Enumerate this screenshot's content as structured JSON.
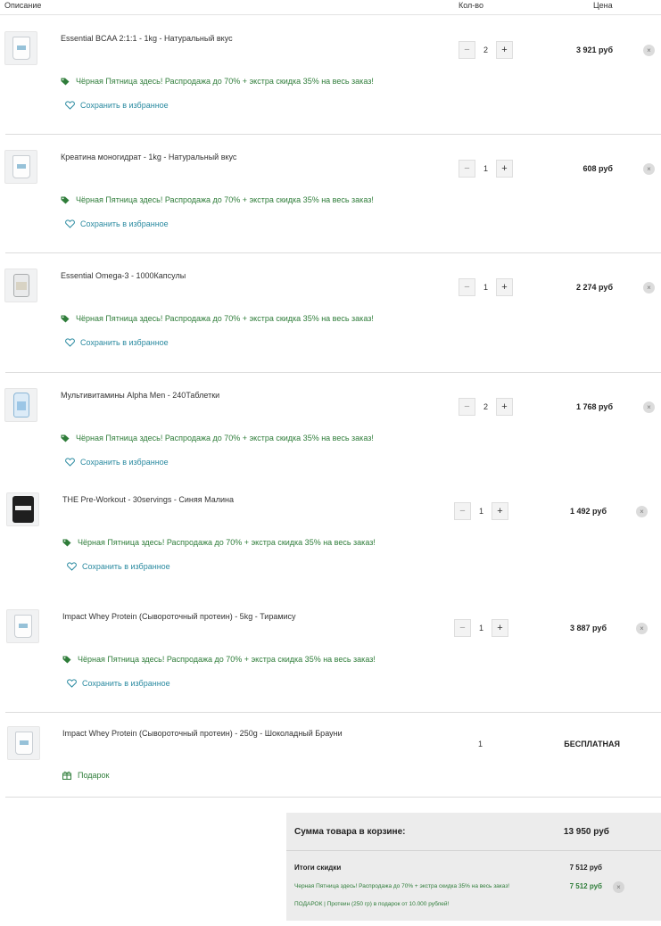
{
  "header": {
    "col_description": "Описание",
    "col_qty": "Кол-во",
    "col_price": "Цена"
  },
  "items": [
    {
      "title": "Essential BCAA 2:1:1 - 1kg - Натуральный вкус",
      "qty": "2",
      "price": "3 921 руб",
      "promo": "Чёрная Пятница здесь! Распродажа до 70% + экстра скидка 35% на весь заказ!",
      "save": "Сохранить в избранное",
      "minus": "−",
      "plus": "+",
      "remove": "×",
      "thumb": "pouch"
    },
    {
      "title": "Креатина моногидрат - 1kg - Натуральный вкус",
      "qty": "1",
      "price": "608 руб",
      "promo": "Чёрная Пятница здесь! Распродажа до 70% + экстра скидка 35% на весь заказ!",
      "save": "Сохранить в избранное",
      "minus": "−",
      "plus": "+",
      "remove": "×",
      "thumb": "pouch"
    },
    {
      "title": "Essential Omega-3 - 1000Капсулы",
      "qty": "1",
      "price": "2 274 руб",
      "promo": "Чёрная Пятница здесь! Распродажа до 70% + экстра скидка 35% на весь заказ!",
      "save": "Сохранить в избранное",
      "minus": "−",
      "plus": "+",
      "remove": "×",
      "thumb": "jar"
    },
    {
      "title": "Мультивитамины Alpha Men - 240Таблетки",
      "qty": "2",
      "price": "1 768 руб",
      "promo": "Чёрная Пятница здесь! Распродажа до 70% + экстра скидка 35% на весь заказ!",
      "save": "Сохранить в избранное",
      "minus": "−",
      "plus": "+",
      "remove": "×",
      "thumb": "bottle"
    },
    {
      "title": "THE Pre-Workout - 30servings - Синяя Малина",
      "qty": "1",
      "price": "1 492 руб",
      "promo": "Чёрная Пятница здесь! Распродажа до 70% + экстра скидка 35% на весь заказ!",
      "save": "Сохранить в избранное",
      "minus": "−",
      "plus": "+",
      "remove": "×",
      "thumb": "tub"
    },
    {
      "title": "Impact Whey Protein (Сывороточный протеин) - 5kg - Тирамису",
      "qty": "1",
      "price": "3 887 руб",
      "promo": "Чёрная Пятница здесь! Распродажа до 70% + экстра скидка 35% на весь заказ!",
      "save": "Сохранить в избранное",
      "minus": "−",
      "plus": "+",
      "remove": "×",
      "thumb": "pouch"
    }
  ],
  "gift_item": {
    "title": "Impact Whey Protein (Сывороточный протеин) - 250g - Шоколадный Брауни",
    "qty": "1",
    "price": "БЕСПЛАТНАЯ",
    "gift_label": "Подарок"
  },
  "summary": {
    "cart_total_label": "Сумма товара в корзине:",
    "cart_total_value": "13 950 руб",
    "discount_title": "Итоги скидки",
    "discount_value": "7 512 руб",
    "promo_line": "Черная Пятница здесь! Распродажа до 70% + экстра скидка 35% на весь заказ!",
    "promo_value": "7 512 руб",
    "promo_remove": "×",
    "gift_line": "ПОДАРОК | Протеин (250 гр) в подарок от 10.000 рублей!"
  },
  "colors": {
    "promo_green": "#2f7d3a",
    "save_link": "#2a8aa0",
    "summary_bg": "#ececec"
  },
  "icons": {
    "promo": "tag-icon",
    "save": "heart-icon",
    "gift": "gift-icon",
    "remove": "close-icon"
  }
}
